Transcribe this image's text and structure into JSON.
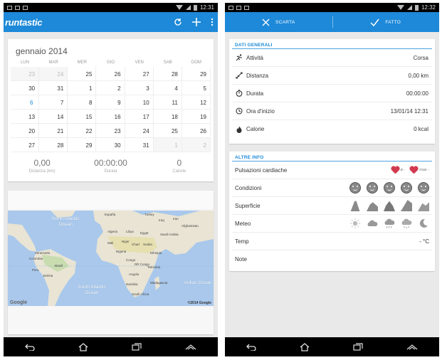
{
  "status_left": {
    "time": "12:31"
  },
  "status_right": {
    "time": "12:32"
  },
  "app": {
    "logo": "runtastic"
  },
  "calendar": {
    "title": "gennaio 2014",
    "weekdays": [
      "LUN",
      "MAR",
      "MER",
      "GIO",
      "VEN",
      "SAB",
      "DOM"
    ],
    "cells": [
      "23",
      "24",
      "25",
      "26",
      "27",
      "28",
      "29",
      "30",
      "31",
      "1",
      "2",
      "3",
      "4",
      "5",
      "6",
      "7",
      "8",
      "9",
      "10",
      "11",
      "12",
      "13",
      "14",
      "15",
      "16",
      "17",
      "18",
      "19",
      "20",
      "21",
      "22",
      "23",
      "24",
      "25",
      "26",
      "27",
      "28",
      "29",
      "30",
      "31",
      "1",
      "2"
    ],
    "stats": [
      {
        "value": "0,00",
        "label": "Distanza (km)"
      },
      {
        "value": "00:00:00",
        "label": "Durata"
      },
      {
        "value": "0",
        "label": "Calorie"
      }
    ]
  },
  "map": {
    "labels": {
      "north_atlantic": "North Atlantic\nOcean",
      "south_atlantic": "South Atlantic\nOcean",
      "indian": "Indian Ocean",
      "spain": "España",
      "turkey": "Turkey",
      "iraq": "Iraq",
      "algeria": "Algeria",
      "libya": "Libya",
      "egypt": "Egypt",
      "iran": "Iran",
      "afghanistan": "Afghanistan",
      "mali": "Mali",
      "niger": "Niger",
      "chad": "Chad",
      "sudan": "Sudan",
      "ethiopia": "Ethiopia",
      "venezuela": "Venezuela",
      "colombia": "Colombia",
      "peru": "Peru",
      "brazil": "Brazil",
      "bolivia": "Bolivia",
      "congo": "Congo",
      "tanzania": "Tanzania",
      "angola": "Angola",
      "namibia": "Namibia",
      "madagascar": "Madagascar",
      "south_africa": "South Africa",
      "saudi": "Saudi Arabia",
      "nigeria": "Nigeria",
      "dr_congo": "DR Congo"
    },
    "google": "Google",
    "copyright": "©2014 Google"
  },
  "edit": {
    "discard": "SCARTA",
    "done": "FATTO"
  },
  "general": {
    "title": "DATI GENERALI",
    "rows": [
      {
        "label": "Attività",
        "value": "Corsa"
      },
      {
        "label": "Distanza",
        "value": "0,00 km"
      },
      {
        "label": "Durata",
        "value": "00:00:00"
      },
      {
        "label": "Ora d'inizio",
        "value": "13/01/14 12:31"
      },
      {
        "label": "Calorie",
        "value": "0 kcal"
      }
    ]
  },
  "extra": {
    "title": "ALTRE INFO",
    "heart_label": "Pulsazioni cardiache",
    "heart_avg": "ø -",
    "heart_max": "max -",
    "conditions_label": "Condizioni",
    "surface_label": "Superficie",
    "weather_label": "Meteo",
    "temp_label": "Temp",
    "temp_value": "- °C",
    "notes_label": "Note"
  },
  "colors": {
    "accent": "#1d89d8",
    "heart": "#d23a4f"
  }
}
